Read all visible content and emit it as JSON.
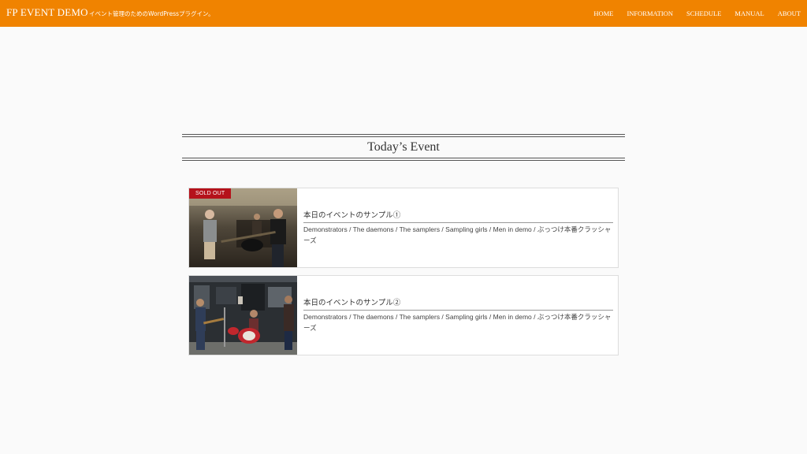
{
  "header": {
    "site_title": "FP EVENT DEMO",
    "tagline": "イベント管理のためのWordPressプラグイン。",
    "background": "#f08300",
    "nav": [
      "HOME",
      "INFORMATION",
      "SCHEDULE",
      "MANUAL",
      "ABOUT"
    ]
  },
  "main": {
    "section_title": "Today’s Event",
    "events": [
      {
        "badge": "SOLD OUT",
        "title": "本日のイベントのサンプル①",
        "description": "Demonstrators / The daemons / The samplers / Sampling girls / Men in demo / ぶっつけ本番クラッシャーズ"
      },
      {
        "title": "本日のイベントのサンプル②",
        "description": "Demonstrators / The daemons / The samplers / Sampling girls / Men in demo / ぶっつけ本番クラッシャーズ"
      }
    ]
  },
  "colors": {
    "badge": "#b5121b",
    "accent": "#f08300"
  }
}
